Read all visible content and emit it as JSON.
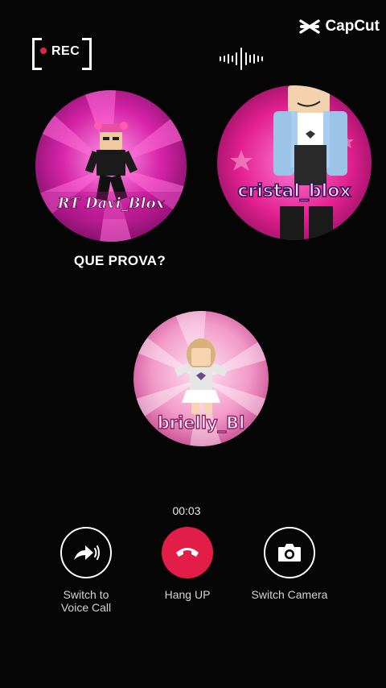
{
  "recording": {
    "label": "REC",
    "color": "#e0263c"
  },
  "watermark": {
    "brand": "CapCut"
  },
  "participants": [
    {
      "username": "RT Davi_Blox",
      "caption": "QUE PROVA?"
    },
    {
      "username": "cristal_blox"
    },
    {
      "username": "brielly_Bl"
    }
  ],
  "call": {
    "duration": "00:03"
  },
  "controls": {
    "voice": {
      "label": "Switch to\nVoice Call",
      "icon": "arrow-sound-icon"
    },
    "hangup": {
      "label": "Hang UP",
      "icon": "phone-hangup-icon",
      "color": "#e11d48"
    },
    "camera": {
      "label": "Switch Camera",
      "icon": "camera-icon"
    }
  },
  "colors": {
    "accent_pink": "#e23fb4",
    "background": "#050505"
  }
}
